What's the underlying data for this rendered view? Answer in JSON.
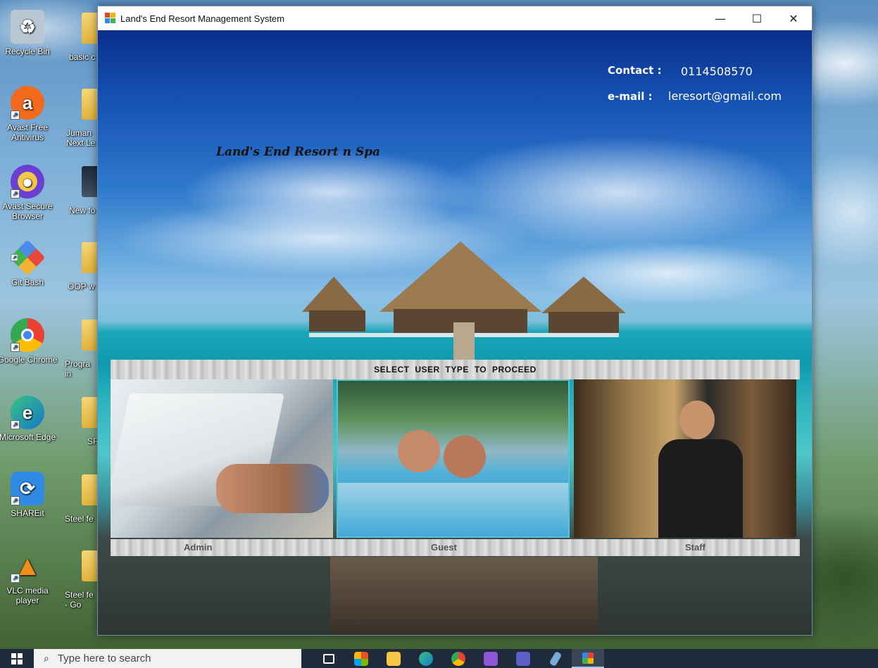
{
  "window": {
    "title": "Land's End Resort Management System",
    "controls": {
      "minimize": "—",
      "maximize": "☐",
      "close": "✕"
    }
  },
  "header": {
    "contact_label": "Contact :",
    "contact_value": "0114508570",
    "email_label": "e-mail :",
    "email_value": "leresort@gmail.com",
    "brand": "Land's End Resort n Spa"
  },
  "selection": {
    "prompt": "SELECT USER TYPE TO PROCEED",
    "tiles": [
      {
        "label": "Admin"
      },
      {
        "label": "Guest"
      },
      {
        "label": "Staff"
      }
    ]
  },
  "desktop": {
    "icons": [
      {
        "label": "Recycle Bin",
        "icon": "recycle-bin-icon",
        "color": "#9fb3c8",
        "glyph": "♻"
      },
      {
        "label": "Avast Free Antivirus",
        "icon": "avast-icon",
        "color": "#f26a1b",
        "glyph": "a"
      },
      {
        "label": "Avast Secure Browser",
        "icon": "avast-browser-icon",
        "color": "#f39c12",
        "glyph": "●"
      },
      {
        "label": "Git Bash",
        "icon": "git-bash-icon",
        "color": "#e7473c",
        "glyph": "◆"
      },
      {
        "label": "Google Chrome",
        "icon": "chrome-icon",
        "color": "#4285f4",
        "glyph": "●"
      },
      {
        "label": "Microsoft Edge",
        "icon": "edge-icon",
        "color": "#1da1c9",
        "glyph": "e"
      },
      {
        "label": "SHAREit",
        "icon": "shareit-icon",
        "color": "#2f8ae6",
        "glyph": "⟳"
      },
      {
        "label": "VLC media player",
        "icon": "vlc-icon",
        "color": "#f28c1a",
        "glyph": "▲"
      }
    ],
    "folders": [
      "basic c",
      "Juman Next Le",
      "New fo",
      "OOP w",
      "Progra in",
      "SF",
      "Steel fe",
      "Steel fe - Go"
    ]
  },
  "taskbar": {
    "search_placeholder": "Type here to search",
    "icons": [
      "task-view-icon",
      "store-icon",
      "file-explorer-icon",
      "edge-icon",
      "chrome-icon",
      "visual-studio-icon",
      "teams-icon",
      "pen-tool-icon",
      "resort-app-icon"
    ]
  }
}
